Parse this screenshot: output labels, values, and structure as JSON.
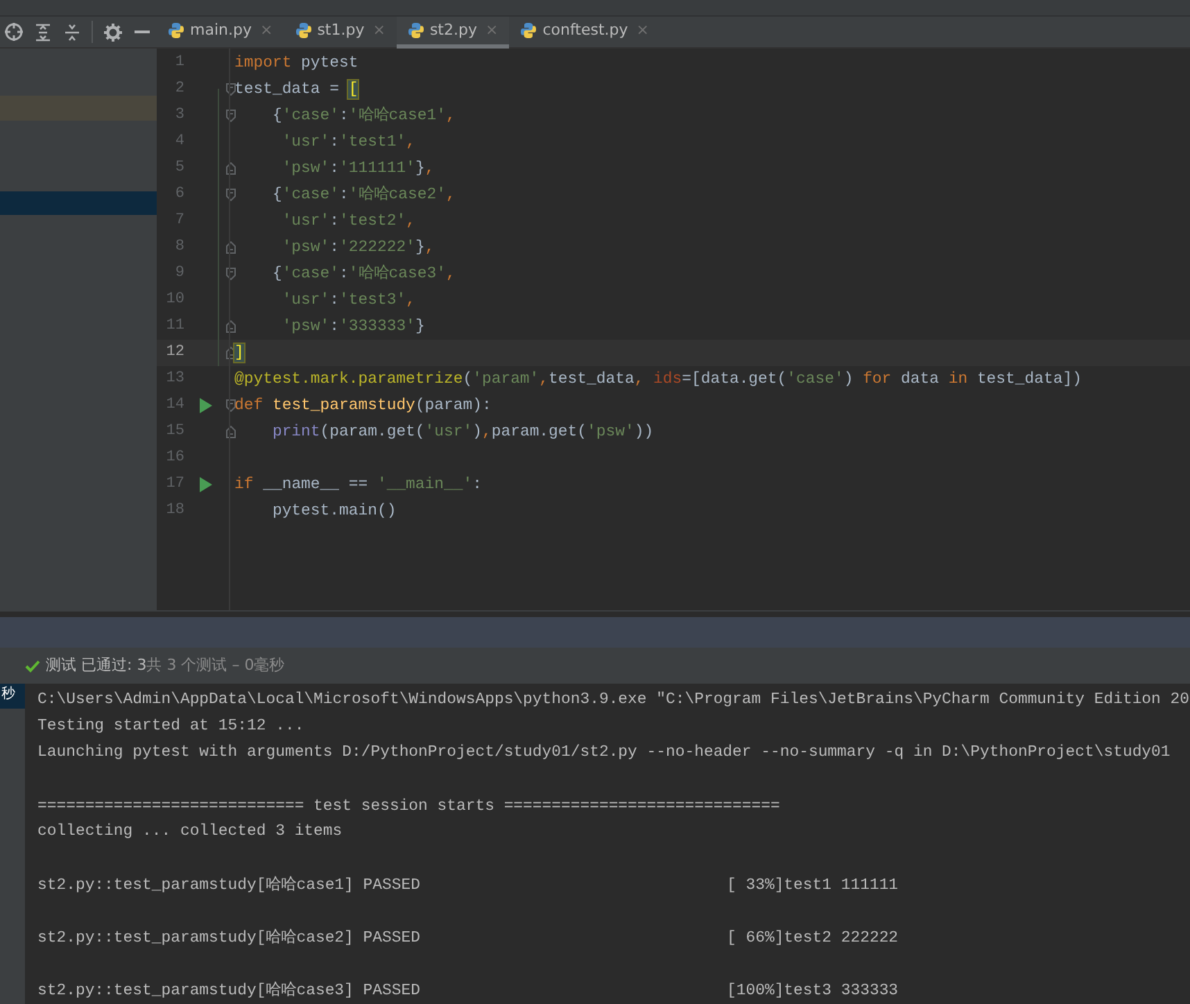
{
  "toolbar": {
    "tools": [
      {
        "kind": "locate"
      },
      {
        "kind": "expand"
      },
      {
        "kind": "collapse"
      },
      {
        "kind": "settings"
      },
      {
        "kind": "hide"
      }
    ]
  },
  "project_panel": {
    "rows": [
      {
        "highlighted": true,
        "selected": false
      },
      {
        "highlighted": false,
        "selected": true
      }
    ]
  },
  "tabs": [
    {
      "label": "main.py",
      "close": "×",
      "selected": false
    },
    {
      "label": "st1.py",
      "close": "×",
      "selected": false
    },
    {
      "label": "st2.py",
      "close": "×",
      "selected": true
    },
    {
      "label": "conftest.py",
      "close": "×",
      "selected": false
    }
  ],
  "editor": {
    "lines": [
      {
        "number": "1",
        "run": false,
        "fold_start": false,
        "fold_end": false,
        "current": false,
        "tokens": [
          {
            "kind": "keyword",
            "text": "import"
          },
          {
            "kind": "plain",
            "text": " pytest"
          }
        ]
      },
      {
        "number": "2",
        "run": false,
        "fold_start": true,
        "fold_end": false,
        "current": false,
        "tokens": [
          {
            "kind": "plain",
            "text": "test_data = "
          },
          {
            "kind": "match",
            "text": "["
          }
        ]
      },
      {
        "number": "3",
        "run": false,
        "fold_start": true,
        "fold_end": false,
        "current": false,
        "tokens": [
          {
            "kind": "plain",
            "text": "    {"
          },
          {
            "kind": "string",
            "text": "'case'"
          },
          {
            "kind": "plain",
            "text": ":"
          },
          {
            "kind": "string",
            "text": "'哈哈case1'"
          },
          {
            "kind": "keyword",
            "text": ","
          }
        ]
      },
      {
        "number": "4",
        "run": false,
        "fold_start": false,
        "fold_end": false,
        "current": false,
        "tokens": [
          {
            "kind": "string",
            "text": "     'usr'"
          },
          {
            "kind": "plain",
            "text": ":"
          },
          {
            "kind": "string",
            "text": "'test1'"
          },
          {
            "kind": "keyword",
            "text": ","
          }
        ]
      },
      {
        "number": "5",
        "run": false,
        "fold_start": false,
        "fold_end": true,
        "current": false,
        "tokens": [
          {
            "kind": "string",
            "text": "     'psw'"
          },
          {
            "kind": "plain",
            "text": ":"
          },
          {
            "kind": "string",
            "text": "'111111'"
          },
          {
            "kind": "plain",
            "text": "}"
          },
          {
            "kind": "keyword",
            "text": ","
          }
        ]
      },
      {
        "number": "6",
        "run": false,
        "fold_start": true,
        "fold_end": false,
        "current": false,
        "tokens": [
          {
            "kind": "plain",
            "text": "    {"
          },
          {
            "kind": "string",
            "text": "'case'"
          },
          {
            "kind": "plain",
            "text": ":"
          },
          {
            "kind": "string",
            "text": "'哈哈case2'"
          },
          {
            "kind": "keyword",
            "text": ","
          }
        ]
      },
      {
        "number": "7",
        "run": false,
        "fold_start": false,
        "fold_end": false,
        "current": false,
        "tokens": [
          {
            "kind": "string",
            "text": "     'usr'"
          },
          {
            "kind": "plain",
            "text": ":"
          },
          {
            "kind": "string",
            "text": "'test2'"
          },
          {
            "kind": "keyword",
            "text": ","
          }
        ]
      },
      {
        "number": "8",
        "run": false,
        "fold_start": false,
        "fold_end": true,
        "current": false,
        "tokens": [
          {
            "kind": "string",
            "text": "     'psw'"
          },
          {
            "kind": "plain",
            "text": ":"
          },
          {
            "kind": "string",
            "text": "'222222'"
          },
          {
            "kind": "plain",
            "text": "}"
          },
          {
            "kind": "keyword",
            "text": ","
          }
        ]
      },
      {
        "number": "9",
        "run": false,
        "fold_start": true,
        "fold_end": false,
        "current": false,
        "tokens": [
          {
            "kind": "plain",
            "text": "    {"
          },
          {
            "kind": "string",
            "text": "'case'"
          },
          {
            "kind": "plain",
            "text": ":"
          },
          {
            "kind": "string",
            "text": "'哈哈case3'"
          },
          {
            "kind": "keyword",
            "text": ","
          }
        ]
      },
      {
        "number": "10",
        "run": false,
        "fold_start": false,
        "fold_end": false,
        "current": false,
        "tokens": [
          {
            "kind": "string",
            "text": "     'usr'"
          },
          {
            "kind": "plain",
            "text": ":"
          },
          {
            "kind": "string",
            "text": "'test3'"
          },
          {
            "kind": "keyword",
            "text": ","
          }
        ]
      },
      {
        "number": "11",
        "run": false,
        "fold_start": false,
        "fold_end": true,
        "current": false,
        "tokens": [
          {
            "kind": "string",
            "text": "     'psw'"
          },
          {
            "kind": "plain",
            "text": ":"
          },
          {
            "kind": "string",
            "text": "'333333'"
          },
          {
            "kind": "plain",
            "text": "}"
          }
        ]
      },
      {
        "number": "12",
        "run": false,
        "fold_start": false,
        "fold_end": true,
        "current": true,
        "tokens": [
          {
            "kind": "match",
            "text": "]"
          }
        ]
      },
      {
        "number": "13",
        "run": false,
        "fold_start": false,
        "fold_end": false,
        "current": false,
        "tokens": [
          {
            "kind": "decorator",
            "text": "@pytest.mark.parametrize"
          },
          {
            "kind": "plain",
            "text": "("
          },
          {
            "kind": "string",
            "text": "'param'"
          },
          {
            "kind": "keyword",
            "text": ","
          },
          {
            "kind": "plain",
            "text": "test_data"
          },
          {
            "kind": "keyword",
            "text": ", "
          },
          {
            "kind": "kwarg",
            "text": "ids"
          },
          {
            "kind": "plain",
            "text": "=[data.get("
          },
          {
            "kind": "string",
            "text": "'case'"
          },
          {
            "kind": "plain",
            "text": ") "
          },
          {
            "kind": "keyword",
            "text": "for"
          },
          {
            "kind": "plain",
            "text": " data "
          },
          {
            "kind": "keyword",
            "text": "in"
          },
          {
            "kind": "plain",
            "text": " test_data])"
          }
        ]
      },
      {
        "number": "14",
        "run": true,
        "fold_start": true,
        "fold_end": false,
        "current": false,
        "tokens": [
          {
            "kind": "keyword",
            "text": "def "
          },
          {
            "kind": "function",
            "text": "test_paramstudy"
          },
          {
            "kind": "plain",
            "text": "(param):"
          }
        ]
      },
      {
        "number": "15",
        "run": false,
        "fold_start": false,
        "fold_end": true,
        "current": false,
        "tokens": [
          {
            "kind": "builtin",
            "text": "    print"
          },
          {
            "kind": "plain",
            "text": "(param.get("
          },
          {
            "kind": "string",
            "text": "'usr'"
          },
          {
            "kind": "plain",
            "text": ")"
          },
          {
            "kind": "keyword",
            "text": ","
          },
          {
            "kind": "plain",
            "text": "param.get("
          },
          {
            "kind": "string",
            "text": "'psw'"
          },
          {
            "kind": "plain",
            "text": "))"
          }
        ]
      },
      {
        "number": "16",
        "run": false,
        "fold_start": false,
        "fold_end": false,
        "current": false
      },
      {
        "number": "17",
        "run": true,
        "fold_start": false,
        "fold_end": false,
        "current": false,
        "tokens": [
          {
            "kind": "keyword",
            "text": "if"
          },
          {
            "kind": "plain",
            "text": " __name__ == "
          },
          {
            "kind": "string",
            "text": "'__main__'"
          },
          {
            "kind": "plain",
            "text": ":"
          }
        ]
      },
      {
        "number": "18",
        "run": false,
        "fold_start": false,
        "fold_end": false,
        "current": false,
        "tokens": [
          {
            "kind": "plain",
            "text": "    pytest.main()"
          }
        ]
      }
    ]
  },
  "test_status": {
    "passed": "测试 已通过: 3",
    "summary": "共 3 个测试 – 0毫秒"
  },
  "test_tree": {
    "items": [
      {
        "label": "秒",
        "selected": true
      }
    ]
  },
  "console": {
    "lines": [
      {
        "text": "C:\\Users\\Admin\\AppData\\Local\\Microsoft\\WindowsApps\\python3.9.exe \"C:\\Program Files\\JetBrains\\PyCharm Community Edition 20",
        "gap_before": false
      },
      {
        "text": "Testing started at 15:12 ...",
        "gap_before": false
      },
      {
        "text": "Launching pytest with arguments D:/PythonProject/study01/st2.py --no-header --no-summary -q in D:\\PythonProject\\study01",
        "gap_before": false
      },
      {
        "text": "============================ test session starts =============================",
        "gap_before": true
      },
      {
        "text": "collecting ... collected 3 items",
        "gap_before": false
      },
      {
        "text": "st2.py::test_paramstudy[哈哈case1] PASSED",
        "output": "[ 33%]test1 111111",
        "gap_before": true
      },
      {
        "text": "st2.py::test_paramstudy[哈哈case2] PASSED",
        "output": "[ 66%]test2 222222",
        "gap_before": true
      },
      {
        "text": "st2.py::test_paramstudy[哈哈case3] PASSED",
        "output": "[100%]test3 333333",
        "gap_before": true
      }
    ]
  }
}
